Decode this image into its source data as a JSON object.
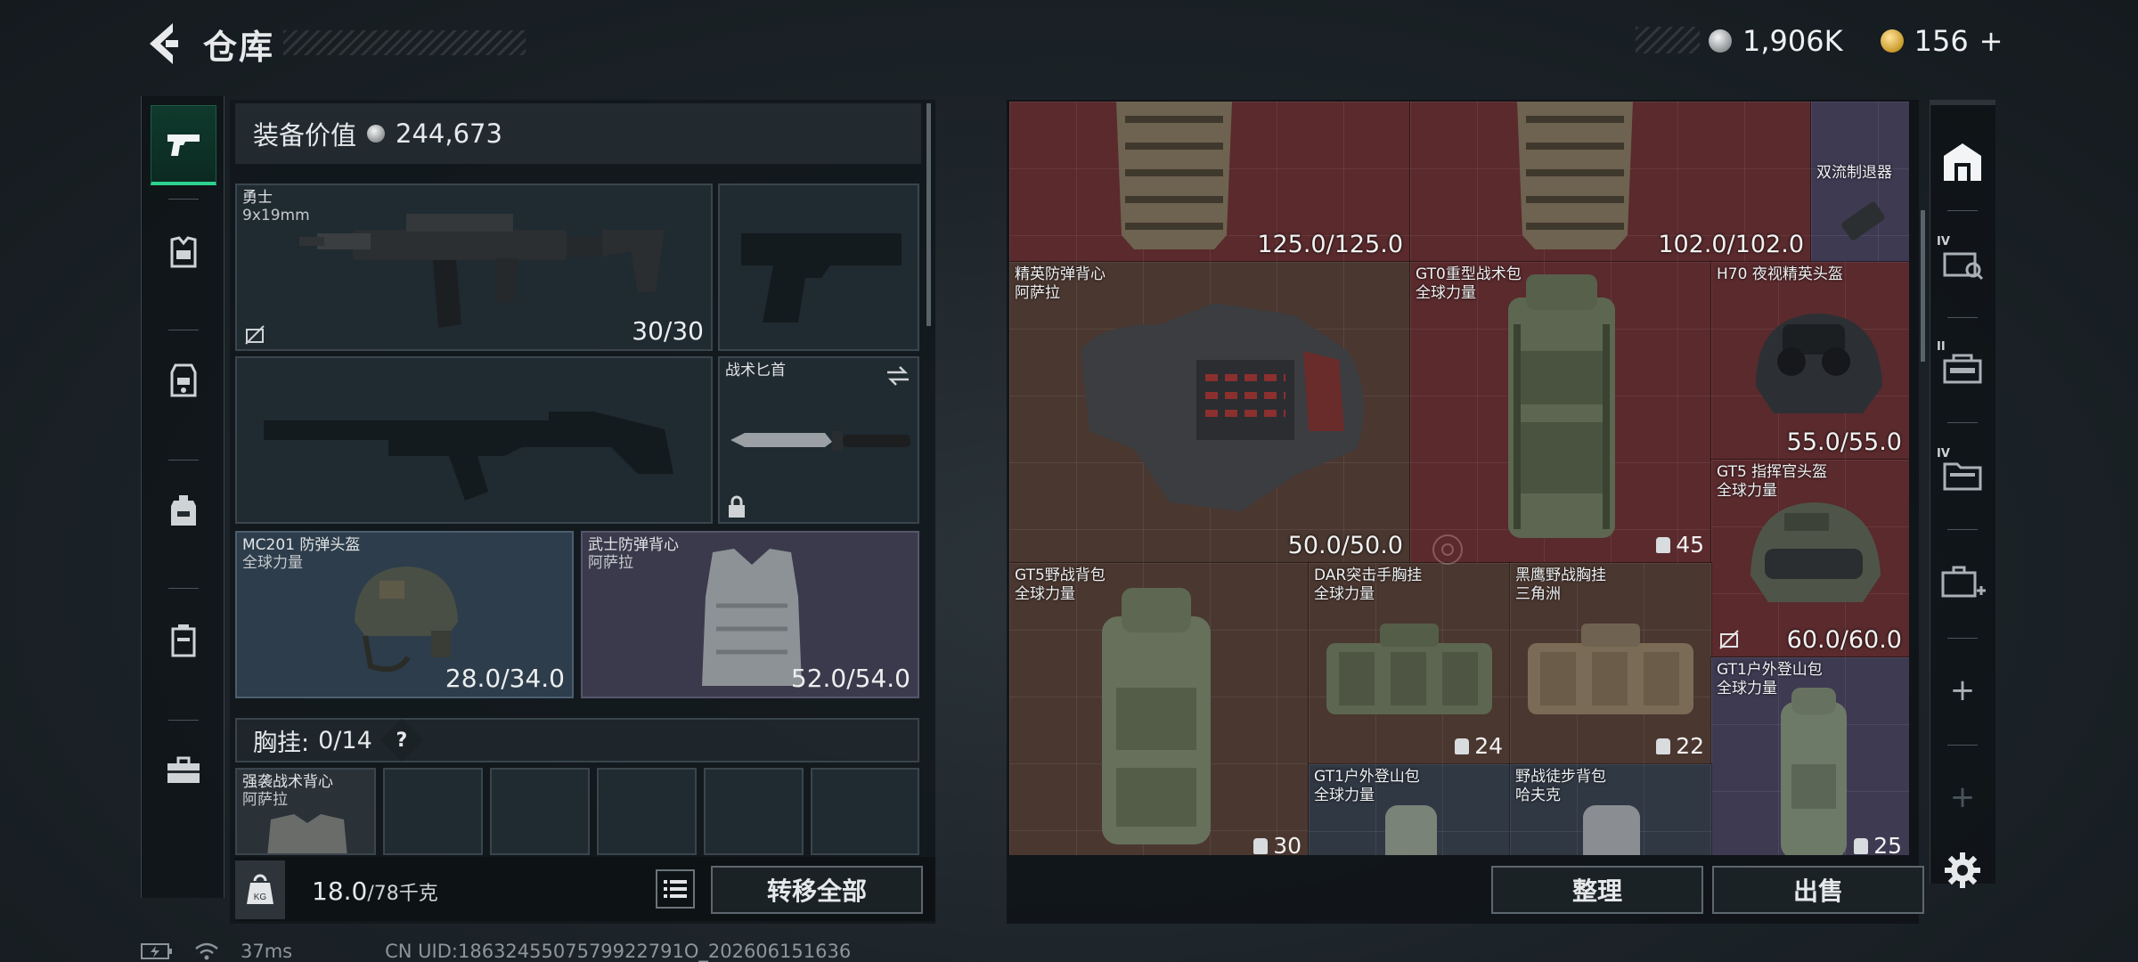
{
  "header": {
    "title": "仓库",
    "currencies": [
      {
        "icon": "silver-coin-icon",
        "value": "1,906K"
      },
      {
        "icon": "gold-coin-icon",
        "value": "156",
        "add": "+"
      }
    ]
  },
  "equipment": {
    "value_label": "装备价值",
    "value": "244,673",
    "primary_weapon": {
      "name": "勇士",
      "caliber": "9x19mm",
      "ammo": "30/30"
    },
    "melee": {
      "name": "战术匕首"
    },
    "helmet": {
      "name": "MC201 防弹头盔",
      "faction": "全球力量",
      "durability": "28.0/34.0"
    },
    "armor": {
      "name": "武士防弹背心",
      "faction": "阿萨拉",
      "durability": "52.0/54.0"
    },
    "chest_rig": {
      "label": "胸挂:",
      "count": "0/14",
      "help": "?",
      "item": {
        "name": "强袭战术背心",
        "faction": "阿萨拉"
      }
    },
    "weight": {
      "value": "18.0",
      "capacity": "/78千克"
    },
    "transfer_all": "转移全部"
  },
  "storage": {
    "items": [
      {
        "durability": "125.0/125.0"
      },
      {
        "durability": "102.0/102.0"
      },
      {
        "name": "双流制退器"
      },
      {
        "name": "精英防弹背心",
        "faction": "阿萨拉",
        "durability": "50.0/50.0"
      },
      {
        "name": "GT0重型战术包",
        "faction": "全球力量",
        "capacity": "45"
      },
      {
        "name": "H70 夜视精英头盔",
        "durability": "55.0/55.0"
      },
      {
        "name": "GT5 指挥官头盔",
        "faction": "全球力量",
        "durability": "60.0/60.0"
      },
      {
        "name": "GT5野战背包",
        "faction": "全球力量",
        "capacity": "30"
      },
      {
        "name": "DAR突击手胸挂",
        "faction": "全球力量",
        "capacity": "24"
      },
      {
        "name": "黑鹰野战胸挂",
        "faction": "三角洲",
        "capacity": "22"
      },
      {
        "name": "GT1户外登山包",
        "faction": "全球力量",
        "capacity": "25"
      },
      {
        "name": "GT1户外登山包",
        "faction": "全球力量"
      },
      {
        "name": "野战徒步背包",
        "faction": "哈夫克"
      }
    ],
    "sort": "整理",
    "sell": "出售"
  },
  "right_rail": {
    "levels": [
      "IV",
      "II",
      "IV"
    ],
    "add": "+"
  },
  "status": {
    "ping": "37ms",
    "uid": "CN UID:1863245507579922791O_202606151636"
  },
  "colors": {
    "accent_green": "#2bd38e",
    "rarity_red": "#5a2a2d",
    "rarity_purple": "#3e3a52",
    "rarity_brown": "#4a3730"
  }
}
